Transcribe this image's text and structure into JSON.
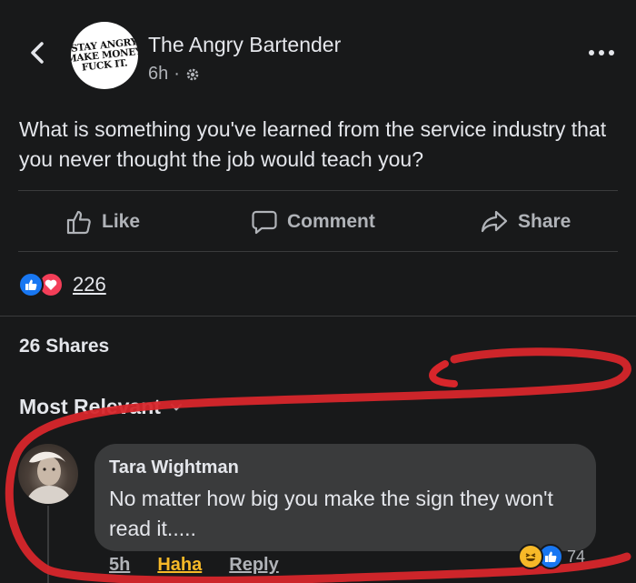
{
  "header": {
    "page_name": "The Angry Bartender",
    "time": "6h",
    "separator": "·",
    "avatar_logo_lines": [
      "STAY ANGRY",
      "MAKE MONEY",
      "FUCK IT."
    ]
  },
  "post": {
    "text": "What is something you've learned from the service industry that you never thought the job would teach you?"
  },
  "actions": {
    "like_label": "Like",
    "comment_label": "Comment",
    "share_label": "Share"
  },
  "reactions": {
    "count": "226"
  },
  "shares_label": "26 Shares",
  "sort_label": "Most Relevant",
  "comment": {
    "author": "Tara Wightman",
    "text": "No matter how big you make the sign they won't read it.....",
    "time": "5h",
    "haha_label": "Haha",
    "reply_label": "Reply",
    "reaction_count": "74"
  },
  "colors": {
    "background": "#18191a",
    "bubble": "#3a3b3c",
    "accent_blue": "#1877f2",
    "haha_yellow": "#f7b928",
    "love_red": "#f33e58",
    "annotation_red": "#d7262b"
  },
  "icons": [
    "back-arrow-icon",
    "more-dots-icon",
    "public-gear-icon",
    "like-thumb-icon",
    "comment-bubble-icon",
    "share-arrow-icon",
    "like-reaction-icon",
    "love-reaction-icon",
    "haha-reaction-icon",
    "chevron-down-icon"
  ]
}
